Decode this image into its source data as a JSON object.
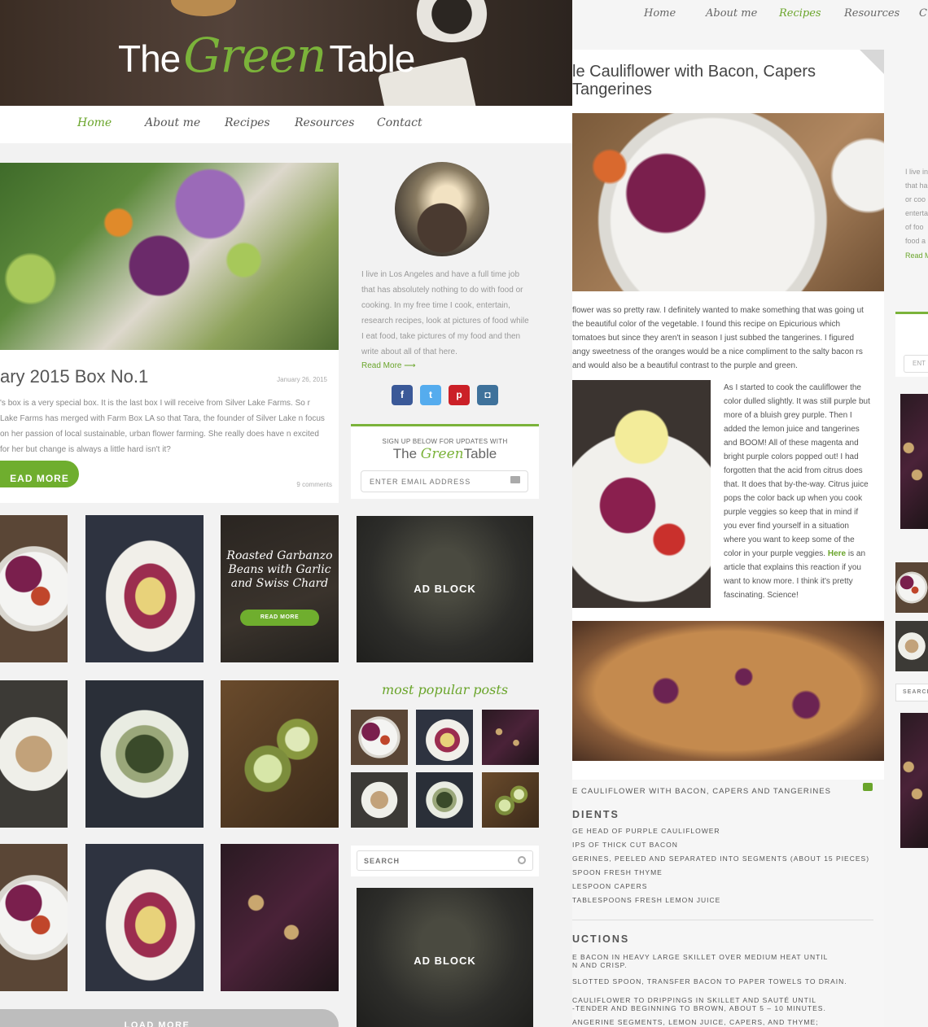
{
  "left_page": {
    "logo": {
      "prefix": "The",
      "green": "Green",
      "suffix": "Table"
    },
    "nav": [
      "Home",
      "About me",
      "Recipes",
      "Resources",
      "Contact"
    ],
    "post": {
      "title": "ary 2015 Box No.1",
      "date": "January 26, 2015",
      "excerpt": "'s box is a very special box. It is the last box I will receive from Silver Lake Farms. So r Lake Farms has merged with Farm Box LA so that Tara, the founder of Silver Lake n focus on her passion of local sustainable, urban flower farming. She really does have n excited for her but change is always a little hard isn't it?",
      "read_more": "EAD MORE",
      "comments": "9 comments"
    },
    "bio": {
      "text": "I live in Los Angeles and have a full time job that has absolutely nothing to do with food or cooking. In my free time I cook, entertain, research recipes, look at pictures of food while I eat food, take pictures of my food and then write about all of that here.",
      "read_more": "Read More"
    },
    "social": [
      {
        "icon": "facebook-icon",
        "glyph": "f",
        "color": "#3b5998"
      },
      {
        "icon": "twitter-icon",
        "glyph": "t",
        "color": "#55acee"
      },
      {
        "icon": "pinterest-icon",
        "glyph": "p",
        "color": "#cb2027"
      },
      {
        "icon": "instagram-icon",
        "glyph": "◘",
        "color": "#3f729b"
      }
    ],
    "signup": {
      "label": "SIGN UP BELOW FOR UPDATES WITH",
      "logo_prefix": "The",
      "logo_green": "Green",
      "logo_suffix": "Table",
      "placeholder": "ENTER EMAIL ADDRESS"
    },
    "feature": {
      "text": "Roasted Garbanzo Beans with Garlic and Swiss Chard",
      "button": "READ MORE"
    },
    "ad_label": "AD BLOCK",
    "popular_title": "most popular posts",
    "search_placeholder": "SEARCH",
    "load_more": "LOAD MORE"
  },
  "right_page": {
    "nav": [
      "Home",
      "About me",
      "Recipes",
      "Resources",
      "C"
    ],
    "title": "le Cauliflower with Bacon, Capers Tangerines",
    "intro": "flower was so pretty raw. I definitely wanted to make something that was going ut the beautiful color of the vegetable. I found this recipe on Epicurious which tomatoes but since they aren't in season I just subbed the tangerines. I figured angy sweetness of the oranges would be a nice compliment to the salty bacon rs and would also be a beautiful contrast to the purple and green.",
    "body": "As I started to cook the cauliflower the color dulled slightly. It was still purple but more of a bluish grey purple. Then I added the lemon juice and tangerines and BOOM! All of these magenta and bright purple colors popped out! I had forgotten that the acid from citrus does that. It does that by-the-way. Citrus juice pops the color back up when you cook purple veggies so keep that in mind if you ever find yourself in a situation where you want to keep some of the color in your purple veggies.",
    "body_link": "Here",
    "body_end": "is an article that explains this reaction if you want to know more. I think it's pretty fascinating. Science!",
    "recipe": {
      "title": "E CAULIFLOWER WITH BACON, CAPERS AND TANGERINES",
      "ingredients_head": "DIENTS",
      "ingredients": [
        "GE HEAD OF PURPLE CAULIFLOWER",
        "IPS OF THICK CUT BACON",
        "GERINES, PEELED AND SEPARATED INTO SEGMENTS (ABOUT 15 PIECES)",
        "SPOON FRESH THYME",
        "LESPOON CAPERS",
        "TABLESPOONS FRESH LEMON JUICE"
      ],
      "instructions_head": "UCTIONS",
      "instructions": [
        "E BACON IN HEAVY LARGE SKILLET OVER MEDIUM HEAT UNTIL",
        "N AND CRISP.",
        "SLOTTED SPOON, TRANSFER BACON TO PAPER TOWELS TO DRAIN.",
        "CAULIFLOWER TO DRIPPINGS IN SKILLET AND SAUTÉ UNTIL",
        "-TENDER AND BEGINNING TO BROWN, ABOUT 5 – 10 MINUTES.",
        "ANGERINE SEGMENTS, LEMON JUICE, CAPERS, AND THYME;"
      ]
    }
  },
  "edge_page": {
    "bio_lines": [
      "I live in",
      "that ha",
      "or coo",
      "enterta",
      "of foo",
      "food a"
    ],
    "read": "Read M",
    "input": "ENT",
    "search": "SEARCH"
  },
  "colors": {
    "accent": "#6aa52b",
    "button": "#6fae2e"
  }
}
